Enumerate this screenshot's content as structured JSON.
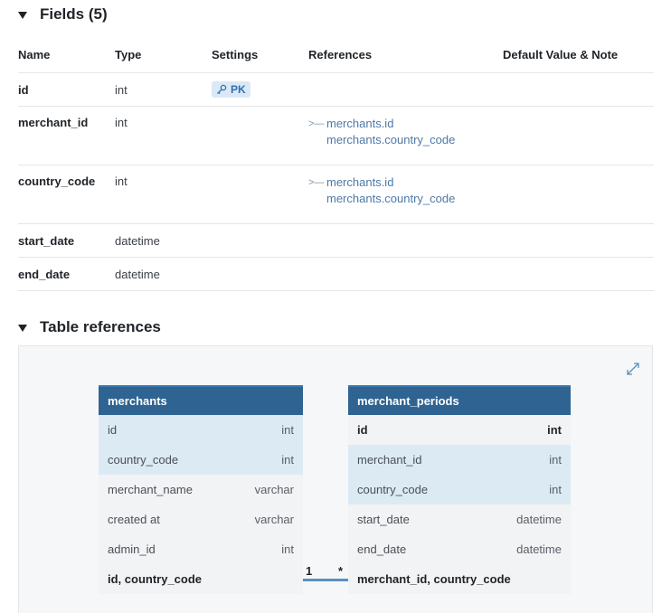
{
  "fields_section": {
    "title": "Fields (5)",
    "columns": [
      "Name",
      "Type",
      "Settings",
      "References",
      "Default Value & Note"
    ],
    "rows": [
      {
        "name": "id",
        "type": "int",
        "setting": "PK",
        "refs": []
      },
      {
        "name": "merchant_id",
        "type": "int",
        "setting": "",
        "refs": [
          "merchants.id",
          "merchants.country_code"
        ]
      },
      {
        "name": "country_code",
        "type": "int",
        "setting": "",
        "refs": [
          "merchants.id",
          "merchants.country_code"
        ]
      },
      {
        "name": "start_date",
        "type": "datetime",
        "setting": "",
        "refs": []
      },
      {
        "name": "end_date",
        "type": "datetime",
        "setting": "",
        "refs": []
      }
    ]
  },
  "references_section": {
    "title": "Table references"
  },
  "diagram": {
    "left_table": {
      "name": "merchants",
      "rows": [
        {
          "field": "id",
          "type": "int"
        },
        {
          "field": "country_code",
          "type": "int"
        },
        {
          "field": "merchant_name",
          "type": "varchar"
        },
        {
          "field": "created at",
          "type": "varchar"
        },
        {
          "field": "admin_id",
          "type": "int"
        },
        {
          "field": "id, country_code",
          "type": ""
        }
      ]
    },
    "right_table": {
      "name": "merchant_periods",
      "rows": [
        {
          "field": "id",
          "type": "int"
        },
        {
          "field": "merchant_id",
          "type": "int"
        },
        {
          "field": "country_code",
          "type": "int"
        },
        {
          "field": "start_date",
          "type": "datetime"
        },
        {
          "field": "end_date",
          "type": "datetime"
        },
        {
          "field": "merchant_id, country_code",
          "type": ""
        }
      ]
    },
    "cardinality_left": "1",
    "cardinality_right": "*"
  },
  "icons": {
    "collapse": "triangle-down-icon",
    "pk": "key-icon",
    "reference": "reference-arrow-icon",
    "expand": "expand-icon"
  },
  "colors": {
    "header_blue": "#2f6391",
    "highlight_row": "#dceaf3",
    "link": "#4d79a7",
    "badge_bg": "#dbe9f7"
  }
}
